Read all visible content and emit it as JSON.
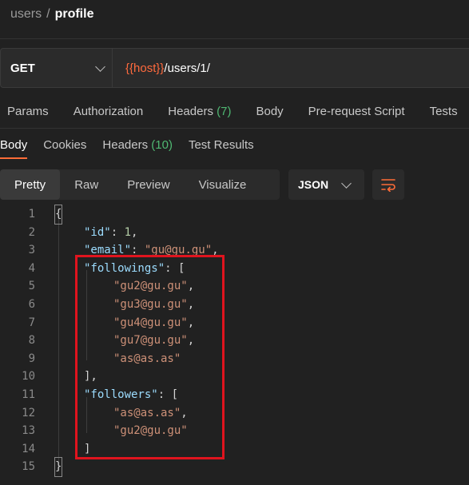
{
  "breadcrumb": {
    "parent": "users",
    "separator": "/",
    "current": "profile"
  },
  "request": {
    "method": "GET",
    "url_host": "{{host}}",
    "url_path": "/users/1/"
  },
  "request_tabs": [
    {
      "label": "Params"
    },
    {
      "label": "Authorization"
    },
    {
      "label": "Headers",
      "count": "(7)"
    },
    {
      "label": "Body"
    },
    {
      "label": "Pre-request Script"
    },
    {
      "label": "Tests"
    }
  ],
  "response_tabs": [
    {
      "label": "Body"
    },
    {
      "label": "Cookies"
    },
    {
      "label": "Headers",
      "count": "(10)"
    },
    {
      "label": "Test Results"
    }
  ],
  "view_modes": [
    "Pretty",
    "Raw",
    "Preview",
    "Visualize"
  ],
  "format": "JSON",
  "icons": {
    "method_dropdown": "chevron-down-icon",
    "format_dropdown": "chevron-down-icon",
    "wrap": "wrap-lines-icon"
  },
  "colors": {
    "accent": "#ff6c37",
    "count": "#4fb872",
    "key": "#9cdcfe",
    "string": "#ce9178",
    "highlight_box": "#e0141e"
  },
  "code": {
    "line_numbers": [
      "1",
      "2",
      "3",
      "4",
      "5",
      "6",
      "7",
      "8",
      "9",
      "10",
      "11",
      "12",
      "13",
      "14",
      "15"
    ],
    "open_brace": "{",
    "close_brace": "}",
    "id_key": "\"id\"",
    "id_value": "1",
    "email_key": "\"email\"",
    "email_value": "\"gu@gu.gu\"",
    "followings_key": "\"followings\"",
    "followings": [
      "\"gu2@gu.gu\"",
      "\"gu3@gu.gu\"",
      "\"gu4@gu.gu\"",
      "\"gu7@gu.gu\"",
      "\"as@as.as\""
    ],
    "followers_key": "\"followers\"",
    "followers": [
      "\"as@as.as\"",
      "\"gu2@gu.gu\""
    ]
  }
}
